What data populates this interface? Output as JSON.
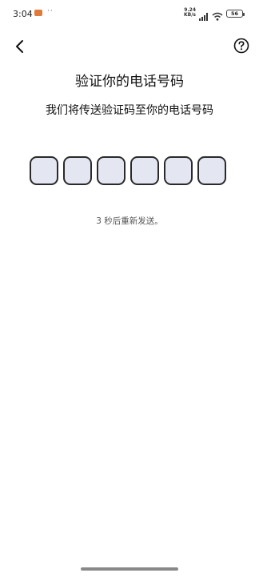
{
  "status_bar": {
    "time": "3:04",
    "notification_dots": "··",
    "net_speed_value": "9.24",
    "net_speed_unit": "KB/s",
    "battery": "56"
  },
  "header": {
    "back_icon": "chevron-left-icon",
    "help_icon": "question-circle-icon"
  },
  "main": {
    "title": "验证你的电话号码",
    "subtitle": "我们将传送验证码至你的电话号码",
    "code_slots": [
      "",
      "",
      "",
      "",
      "",
      ""
    ],
    "resend_text": "3 秒后重新发送。"
  },
  "colors": {
    "code_box_fill": "#e4e6f2",
    "code_box_border": "#2a2a2a",
    "text": "#111111",
    "muted_text": "#555555"
  }
}
